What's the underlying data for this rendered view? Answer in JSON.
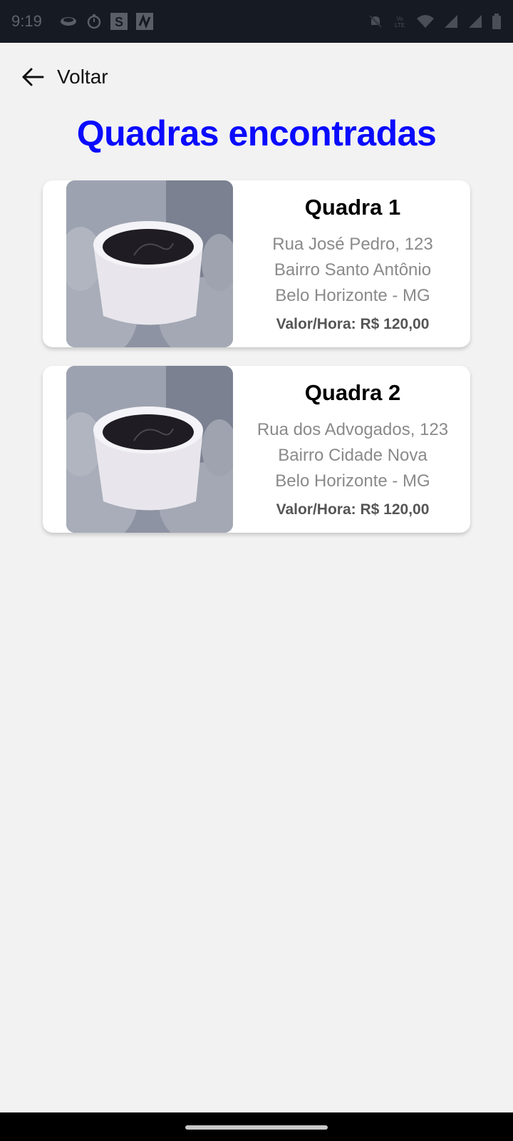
{
  "status_bar": {
    "time": "9:19"
  },
  "header": {
    "back_label": "Voltar"
  },
  "title": "Quadras encontradas",
  "courts": [
    {
      "name": "Quadra 1",
      "street": "Rua José Pedro, 123",
      "neighborhood": "Bairro Santo Antônio",
      "city": "Belo Horizonte - MG",
      "price": "Valor/Hora: R$ 120,00"
    },
    {
      "name": "Quadra 2",
      "street": "Rua dos Advogados, 123",
      "neighborhood": "Bairro Cidade Nova",
      "city": "Belo Horizonte - MG",
      "price": "Valor/Hora: R$ 120,00"
    }
  ],
  "colors": {
    "title": "#0a0aff",
    "background": "#f2f2f2",
    "status_bar": "#161a22"
  },
  "icons": {
    "back": "arrow-left-icon",
    "image": "coffee-cup-photo"
  }
}
